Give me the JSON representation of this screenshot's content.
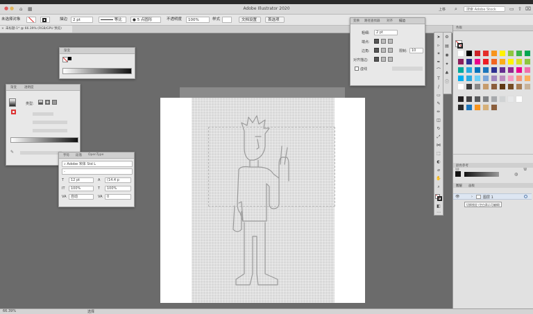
{
  "window": {
    "title": "Adobe Illustrator 2020",
    "workspace_label": "上移",
    "search_placeholder": "搜索 Adobe Stock"
  },
  "control_bar": {
    "selection_label": "未选择对象",
    "profile_label": "描边",
    "stroke_weight": "2 pt",
    "line_style": "等比",
    "brush_label": "5 点圆形",
    "opacity_label": "不透明度",
    "opacity_value": "100%",
    "style_label": "样式",
    "doc_setup_button": "文档设置",
    "preferences_button": "首选项"
  },
  "document_tab": {
    "label": "未标题-1* @ 66.39% (RGB/GPU 预览)"
  },
  "gradient_panel": {
    "title": "渐变"
  },
  "appearance_panel": {
    "tabs": [
      "渐变",
      "透明度"
    ],
    "type_label": "类型:"
  },
  "character_panel": {
    "tabs": [
      "字符",
      "段落",
      "OpenType"
    ],
    "font_family": "Adobe 宋体 Std L",
    "font_style": "-",
    "font_size": "12 pt",
    "leading": "(14.4 p",
    "vertical_scale": "100%",
    "horizontal_scale": "100%",
    "kerning": "自动",
    "tracking": "0"
  },
  "stroke_panel": {
    "tabs": [
      "变换",
      "路径查找器",
      "对齐",
      "描边"
    ],
    "weight_label": "粗细:",
    "weight_value": "2 pt",
    "cap_label": "端点:",
    "corner_label": "边角:",
    "limit_label": "限制:",
    "limit_value": "10",
    "align_label": "对齐描边:",
    "dashed_label": "虚线"
  },
  "swatches_panel": {
    "title": "色板",
    "colors": [
      [
        "#ffffff",
        "#000000",
        "#cc2127",
        "#e42e2a",
        "#f7941d",
        "#fff200",
        "#8dc63f",
        "#39b54a",
        "#00a651"
      ],
      [
        "#8b1e5c",
        "#2e3192",
        "#ec008c",
        "#ed1c24",
        "#f26522",
        "#fbad18",
        "#fff200",
        "#d7df23",
        "#8dc63f"
      ],
      [
        "#00a99d",
        "#27aae1",
        "#0072bc",
        "#1b75bc",
        "#2e3192",
        "#662d91",
        "#92278f",
        "#ec008c",
        "#f06eaa"
      ],
      [
        "#00aeef",
        "#29abe2",
        "#6dcff6",
        "#7da7d9",
        "#a186be",
        "#bd8cbf",
        "#f49ac1",
        "#f7977a",
        "#fbaf5d"
      ],
      [
        "#ffffff",
        "#3c3c3c",
        "#888888",
        "#c69c6d",
        "#8b5e3c",
        "#603913",
        "#754c24",
        "#a67c52",
        "#c7b299"
      ],
      [
        "#231f20",
        "#414042",
        "#58595b",
        "#808285",
        "#a7a9ac",
        "#d1d3d4",
        "#e6e7e8",
        "#ffffff"
      ],
      [
        "#2b2b2b",
        "#1b75bc",
        "#f7941d",
        "#d6b079",
        "#8b5e3c"
      ]
    ]
  },
  "color_guide": {
    "title": "颜色参考"
  },
  "layers_panel": {
    "tabs": [
      "图层",
      "画板"
    ],
    "layer_name": "图层 1",
    "tooltip": "切换锁定 (空白表示可编辑)"
  },
  "status_bar": {
    "zoom": "66.39%",
    "tool_label": "选择"
  }
}
